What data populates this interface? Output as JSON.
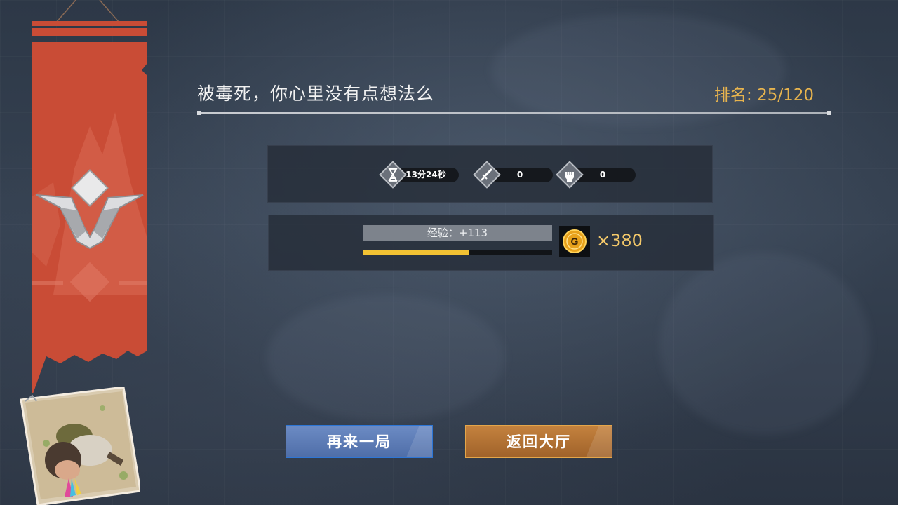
{
  "result": {
    "title": "被毒死，你心里没有点想法么",
    "rank_label": "排名:",
    "rank_value": "25/120"
  },
  "stats": {
    "survival_time": "13分24秒",
    "kills": "0",
    "damage_punches": "0"
  },
  "rewards": {
    "exp_label": "经验：+113",
    "exp_progress": 0.56,
    "coins": "×380",
    "coin_icon": "G"
  },
  "buttons": {
    "play_again": "再来一局",
    "back_to_lobby": "返回大厅"
  },
  "colors": {
    "banner": "#c94c36",
    "rank": "#e8b44e",
    "exp_fill": "#f2c233",
    "btn_again": "#5877b1",
    "btn_lobby": "#b3723a"
  }
}
